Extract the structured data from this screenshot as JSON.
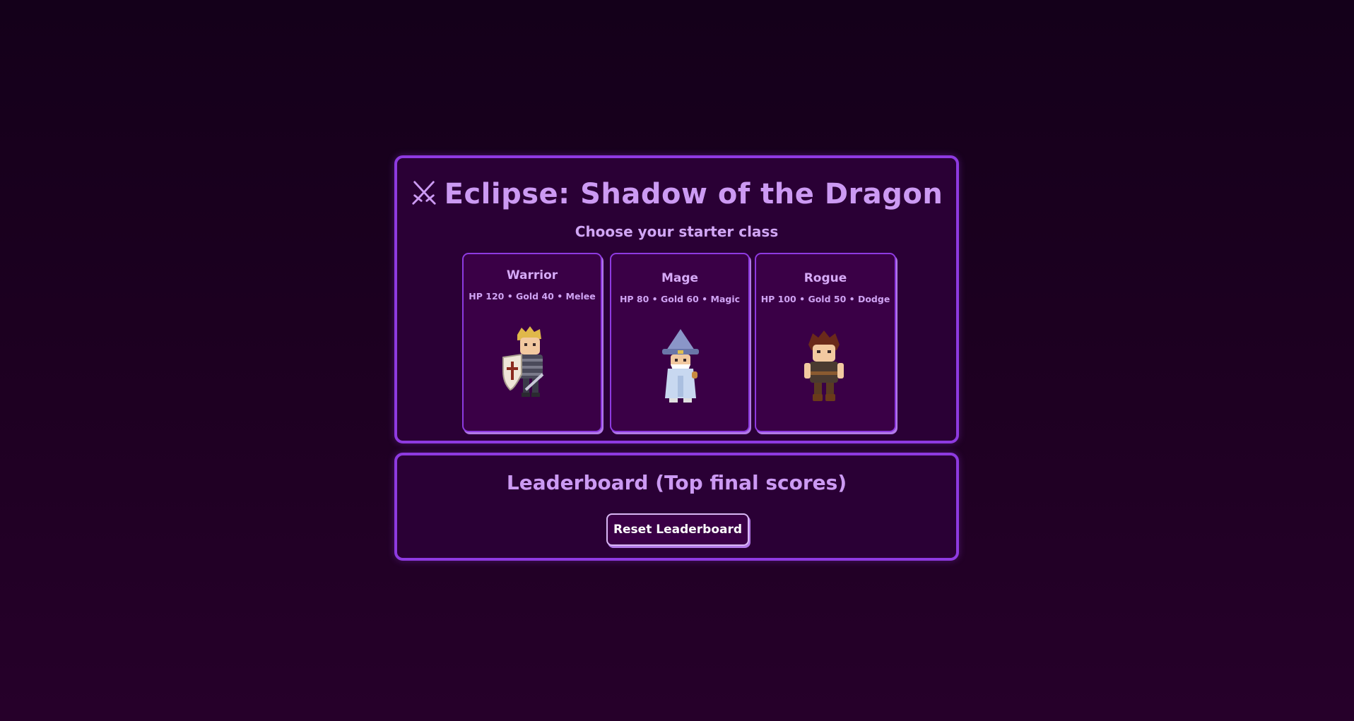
{
  "start_screen": {
    "title_icon": "crossed-swords-icon",
    "title": "Eclipse: Shadow of the Dragon",
    "subtitle": "Choose your starter class",
    "classes": [
      {
        "name": "Warrior",
        "stats": "HP 120 • Gold 40 • Melee",
        "sprite": "warrior-sprite-icon"
      },
      {
        "name": "Mage",
        "stats": "HP 80 • Gold 60 • Magic",
        "sprite": "mage-sprite-icon"
      },
      {
        "name": "Rogue",
        "stats": "HP 100 • Gold 50 • Dodge",
        "sprite": "rogue-sprite-icon"
      }
    ]
  },
  "leaderboard": {
    "title": "Leaderboard (Top final scores)",
    "reset_label": "Reset Leaderboard"
  },
  "colors": {
    "accent": "#8e3ae0",
    "title": "#cc9af3",
    "panel_bg": "#2a0035",
    "page_bg": "#14001a"
  }
}
